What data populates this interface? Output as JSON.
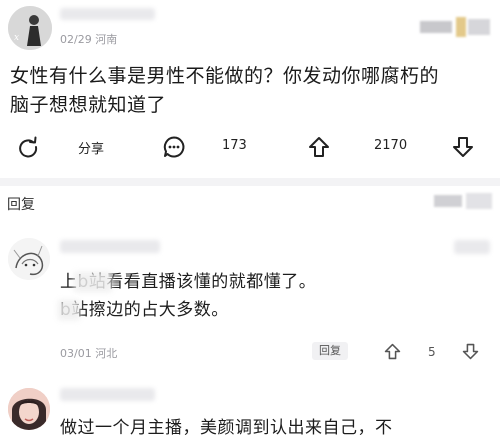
{
  "post": {
    "meta": "02/29 河南",
    "text_line1": "女性有什么事是男性不能做的？你发动你哪腐朽的",
    "text_line2": "脑子想想就知道了"
  },
  "actions": {
    "share_label": "分享",
    "comment_count": "173",
    "upvote_count": "2170"
  },
  "replies_section": {
    "label": "回复"
  },
  "comments": [
    {
      "line1": "上b站看看直播该懂的就都懂了。",
      "line2": "b站擦边的占大多数。",
      "meta": "03/01 河北",
      "reply_label": "回复",
      "vote_count": "5"
    },
    {
      "line1": "做过一个月主播，美颜调到认出来自己，不"
    }
  ],
  "icons": [
    "share-icon",
    "comment-icon",
    "upvote-icon",
    "downvote-icon"
  ]
}
